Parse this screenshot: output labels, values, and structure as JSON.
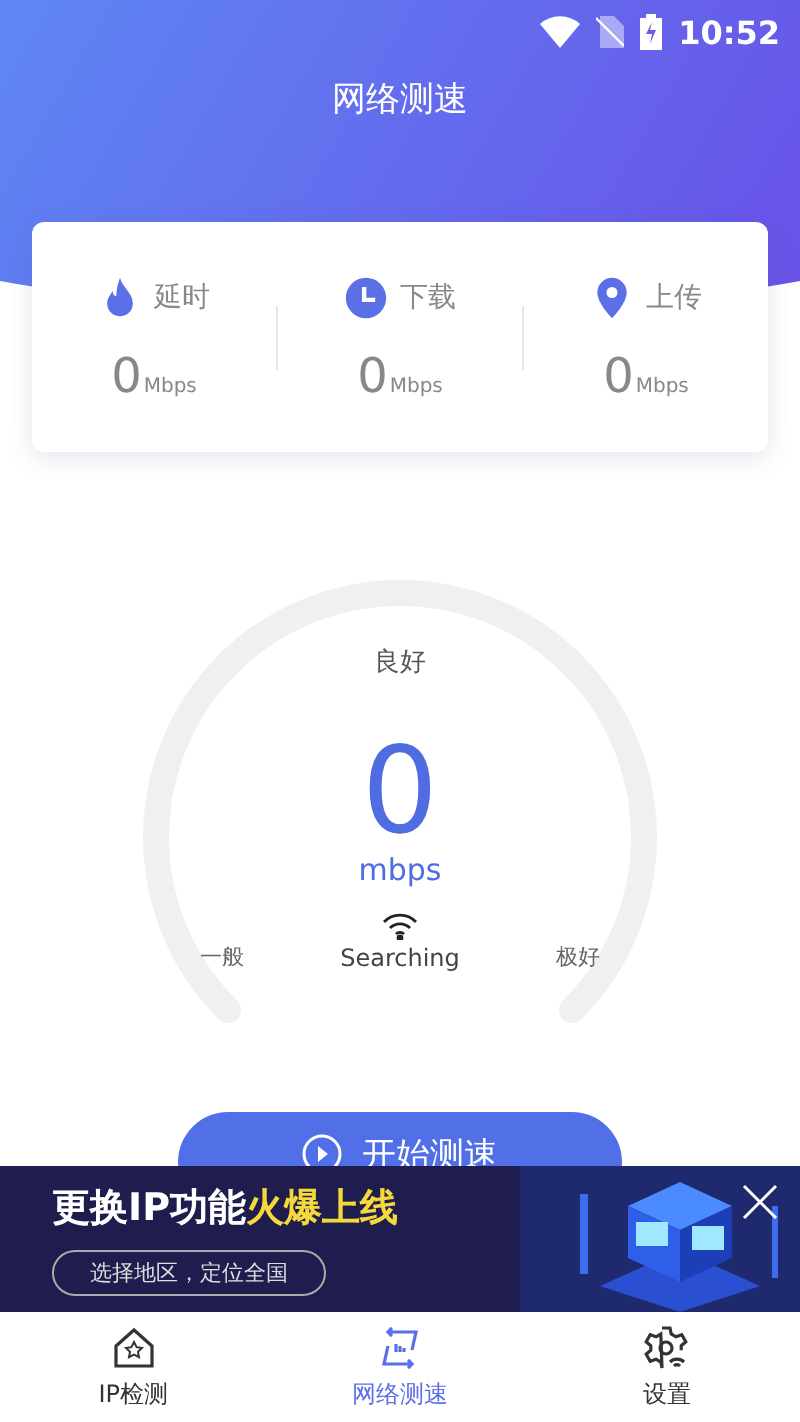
{
  "status_bar": {
    "time": "10:52"
  },
  "header": {
    "title": "网络测速"
  },
  "stats": [
    {
      "kind": "latency",
      "label": "延时",
      "value": "0",
      "unit": "Mbps"
    },
    {
      "kind": "download",
      "label": "下载",
      "value": "0",
      "unit": "Mbps"
    },
    {
      "kind": "upload",
      "label": "上传",
      "value": "0",
      "unit": "Mbps"
    }
  ],
  "gauge": {
    "rating": "良好",
    "value": "0",
    "unit": "mbps",
    "status": "Searching",
    "min_label": "一般",
    "max_label": "极好"
  },
  "start_button": {
    "label": "开始测速"
  },
  "banner": {
    "headline": "更换IP功能",
    "headline_highlight": "火爆上线",
    "subtitle": "选择地区，定位全国"
  },
  "tabs": [
    {
      "kind": "ip",
      "label": "IP检测",
      "selected": false
    },
    {
      "kind": "speed",
      "label": "网络测速",
      "selected": true
    },
    {
      "kind": "settings",
      "label": "设置",
      "selected": false
    }
  ]
}
